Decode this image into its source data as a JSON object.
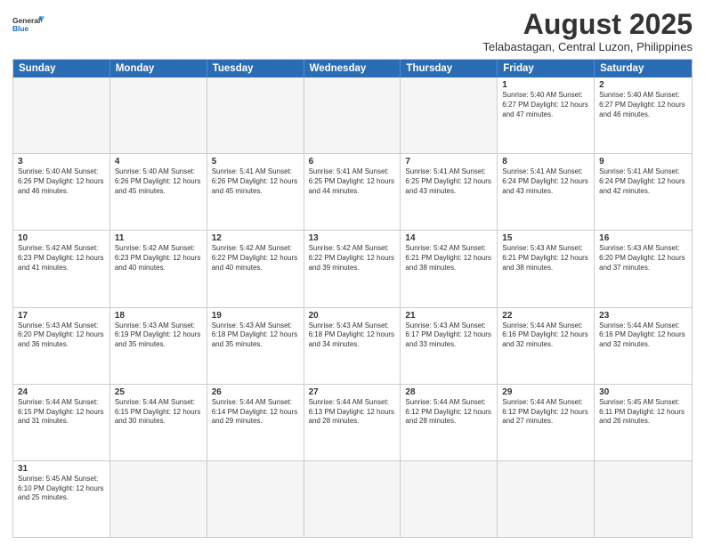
{
  "header": {
    "logo_line1": "General",
    "logo_line2": "Blue",
    "month_year": "August 2025",
    "location": "Telabastagan, Central Luzon, Philippines"
  },
  "weekdays": [
    "Sunday",
    "Monday",
    "Tuesday",
    "Wednesday",
    "Thursday",
    "Friday",
    "Saturday"
  ],
  "rows": [
    [
      {
        "num": "",
        "info": "",
        "empty": true
      },
      {
        "num": "",
        "info": "",
        "empty": true
      },
      {
        "num": "",
        "info": "",
        "empty": true
      },
      {
        "num": "",
        "info": "",
        "empty": true
      },
      {
        "num": "",
        "info": "",
        "empty": true
      },
      {
        "num": "1",
        "info": "Sunrise: 5:40 AM\nSunset: 6:27 PM\nDaylight: 12 hours\nand 47 minutes.",
        "empty": false
      },
      {
        "num": "2",
        "info": "Sunrise: 5:40 AM\nSunset: 6:27 PM\nDaylight: 12 hours\nand 46 minutes.",
        "empty": false
      }
    ],
    [
      {
        "num": "3",
        "info": "Sunrise: 5:40 AM\nSunset: 6:26 PM\nDaylight: 12 hours\nand 46 minutes.",
        "empty": false
      },
      {
        "num": "4",
        "info": "Sunrise: 5:40 AM\nSunset: 6:26 PM\nDaylight: 12 hours\nand 45 minutes.",
        "empty": false
      },
      {
        "num": "5",
        "info": "Sunrise: 5:41 AM\nSunset: 6:26 PM\nDaylight: 12 hours\nand 45 minutes.",
        "empty": false
      },
      {
        "num": "6",
        "info": "Sunrise: 5:41 AM\nSunset: 6:25 PM\nDaylight: 12 hours\nand 44 minutes.",
        "empty": false
      },
      {
        "num": "7",
        "info": "Sunrise: 5:41 AM\nSunset: 6:25 PM\nDaylight: 12 hours\nand 43 minutes.",
        "empty": false
      },
      {
        "num": "8",
        "info": "Sunrise: 5:41 AM\nSunset: 6:24 PM\nDaylight: 12 hours\nand 43 minutes.",
        "empty": false
      },
      {
        "num": "9",
        "info": "Sunrise: 5:41 AM\nSunset: 6:24 PM\nDaylight: 12 hours\nand 42 minutes.",
        "empty": false
      }
    ],
    [
      {
        "num": "10",
        "info": "Sunrise: 5:42 AM\nSunset: 6:23 PM\nDaylight: 12 hours\nand 41 minutes.",
        "empty": false
      },
      {
        "num": "11",
        "info": "Sunrise: 5:42 AM\nSunset: 6:23 PM\nDaylight: 12 hours\nand 40 minutes.",
        "empty": false
      },
      {
        "num": "12",
        "info": "Sunrise: 5:42 AM\nSunset: 6:22 PM\nDaylight: 12 hours\nand 40 minutes.",
        "empty": false
      },
      {
        "num": "13",
        "info": "Sunrise: 5:42 AM\nSunset: 6:22 PM\nDaylight: 12 hours\nand 39 minutes.",
        "empty": false
      },
      {
        "num": "14",
        "info": "Sunrise: 5:42 AM\nSunset: 6:21 PM\nDaylight: 12 hours\nand 38 minutes.",
        "empty": false
      },
      {
        "num": "15",
        "info": "Sunrise: 5:43 AM\nSunset: 6:21 PM\nDaylight: 12 hours\nand 38 minutes.",
        "empty": false
      },
      {
        "num": "16",
        "info": "Sunrise: 5:43 AM\nSunset: 6:20 PM\nDaylight: 12 hours\nand 37 minutes.",
        "empty": false
      }
    ],
    [
      {
        "num": "17",
        "info": "Sunrise: 5:43 AM\nSunset: 6:20 PM\nDaylight: 12 hours\nand 36 minutes.",
        "empty": false
      },
      {
        "num": "18",
        "info": "Sunrise: 5:43 AM\nSunset: 6:19 PM\nDaylight: 12 hours\nand 35 minutes.",
        "empty": false
      },
      {
        "num": "19",
        "info": "Sunrise: 5:43 AM\nSunset: 6:18 PM\nDaylight: 12 hours\nand 35 minutes.",
        "empty": false
      },
      {
        "num": "20",
        "info": "Sunrise: 5:43 AM\nSunset: 6:18 PM\nDaylight: 12 hours\nand 34 minutes.",
        "empty": false
      },
      {
        "num": "21",
        "info": "Sunrise: 5:43 AM\nSunset: 6:17 PM\nDaylight: 12 hours\nand 33 minutes.",
        "empty": false
      },
      {
        "num": "22",
        "info": "Sunrise: 5:44 AM\nSunset: 6:16 PM\nDaylight: 12 hours\nand 32 minutes.",
        "empty": false
      },
      {
        "num": "23",
        "info": "Sunrise: 5:44 AM\nSunset: 6:16 PM\nDaylight: 12 hours\nand 32 minutes.",
        "empty": false
      }
    ],
    [
      {
        "num": "24",
        "info": "Sunrise: 5:44 AM\nSunset: 6:15 PM\nDaylight: 12 hours\nand 31 minutes.",
        "empty": false
      },
      {
        "num": "25",
        "info": "Sunrise: 5:44 AM\nSunset: 6:15 PM\nDaylight: 12 hours\nand 30 minutes.",
        "empty": false
      },
      {
        "num": "26",
        "info": "Sunrise: 5:44 AM\nSunset: 6:14 PM\nDaylight: 12 hours\nand 29 minutes.",
        "empty": false
      },
      {
        "num": "27",
        "info": "Sunrise: 5:44 AM\nSunset: 6:13 PM\nDaylight: 12 hours\nand 28 minutes.",
        "empty": false
      },
      {
        "num": "28",
        "info": "Sunrise: 5:44 AM\nSunset: 6:12 PM\nDaylight: 12 hours\nand 28 minutes.",
        "empty": false
      },
      {
        "num": "29",
        "info": "Sunrise: 5:44 AM\nSunset: 6:12 PM\nDaylight: 12 hours\nand 27 minutes.",
        "empty": false
      },
      {
        "num": "30",
        "info": "Sunrise: 5:45 AM\nSunset: 6:11 PM\nDaylight: 12 hours\nand 26 minutes.",
        "empty": false
      }
    ],
    [
      {
        "num": "31",
        "info": "Sunrise: 5:45 AM\nSunset: 6:10 PM\nDaylight: 12 hours\nand 25 minutes.",
        "empty": false
      },
      {
        "num": "",
        "info": "",
        "empty": true
      },
      {
        "num": "",
        "info": "",
        "empty": true
      },
      {
        "num": "",
        "info": "",
        "empty": true
      },
      {
        "num": "",
        "info": "",
        "empty": true
      },
      {
        "num": "",
        "info": "",
        "empty": true
      },
      {
        "num": "",
        "info": "",
        "empty": true
      }
    ]
  ]
}
